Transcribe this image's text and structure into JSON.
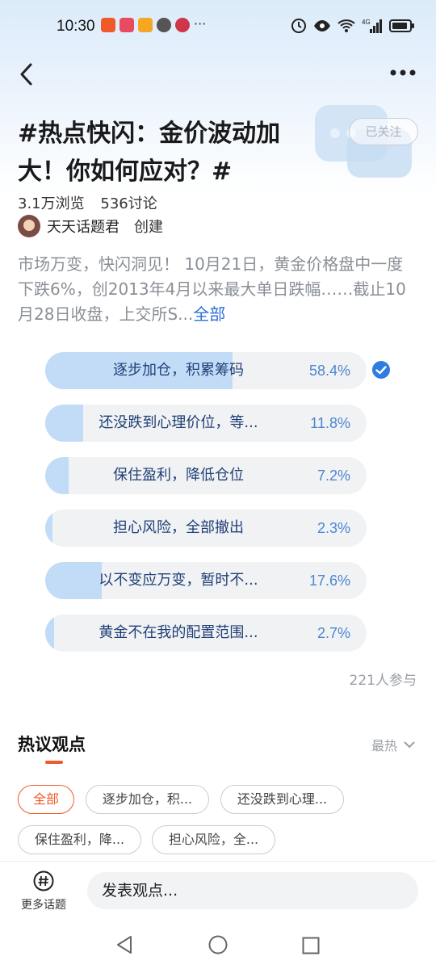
{
  "status_bar": {
    "time": "10:30",
    "more": "···"
  },
  "header": {
    "title": "#热点快闪：金价波动加大！你如何应对？#",
    "follow_label": "已关注",
    "views": "3.1万浏览",
    "discussions": "536讨论",
    "creator_name": "天天话题君",
    "creator_action": "创建",
    "description": "市场万变，快闪洞见！ 10月21日，黄金价格盘中一度下跌6%，创2013年4月以来最大单日跌幅……截止10月28日收盘，上交所S...",
    "description_more": "全部"
  },
  "poll": {
    "options": [
      {
        "label": "逐步加仓，积累筹码",
        "percent_text": "58.4%",
        "fraction": 0.584,
        "selected": true
      },
      {
        "label": "还没跌到心理价位，等...",
        "percent_text": "11.8%",
        "fraction": 0.118,
        "selected": false
      },
      {
        "label": "保住盈利，降低仓位",
        "percent_text": "7.2%",
        "fraction": 0.072,
        "selected": false
      },
      {
        "label": "担心风险，全部撤出",
        "percent_text": "2.3%",
        "fraction": 0.023,
        "selected": false
      },
      {
        "label": "以不变应万变，暂时不...",
        "percent_text": "17.6%",
        "fraction": 0.176,
        "selected": false
      },
      {
        "label": "黄金不在我的配置范围...",
        "percent_text": "2.7%",
        "fraction": 0.027,
        "selected": false
      }
    ],
    "participants": "221人参与"
  },
  "opinions": {
    "title": "热议观点",
    "sort_label": "最热",
    "chips": [
      "全部",
      "逐步加仓，积...",
      "还没跌到心理...",
      "保住盈利，降...",
      "担心风险，全..."
    ]
  },
  "bottom": {
    "more_topics_label": "更多话题",
    "input_placeholder": "发表观点..."
  },
  "colors": {
    "accent_orange": "#f05a28",
    "poll_fill": "#c2dcf7",
    "poll_text": "#1f3f77",
    "link_blue": "#2a6fd6"
  }
}
